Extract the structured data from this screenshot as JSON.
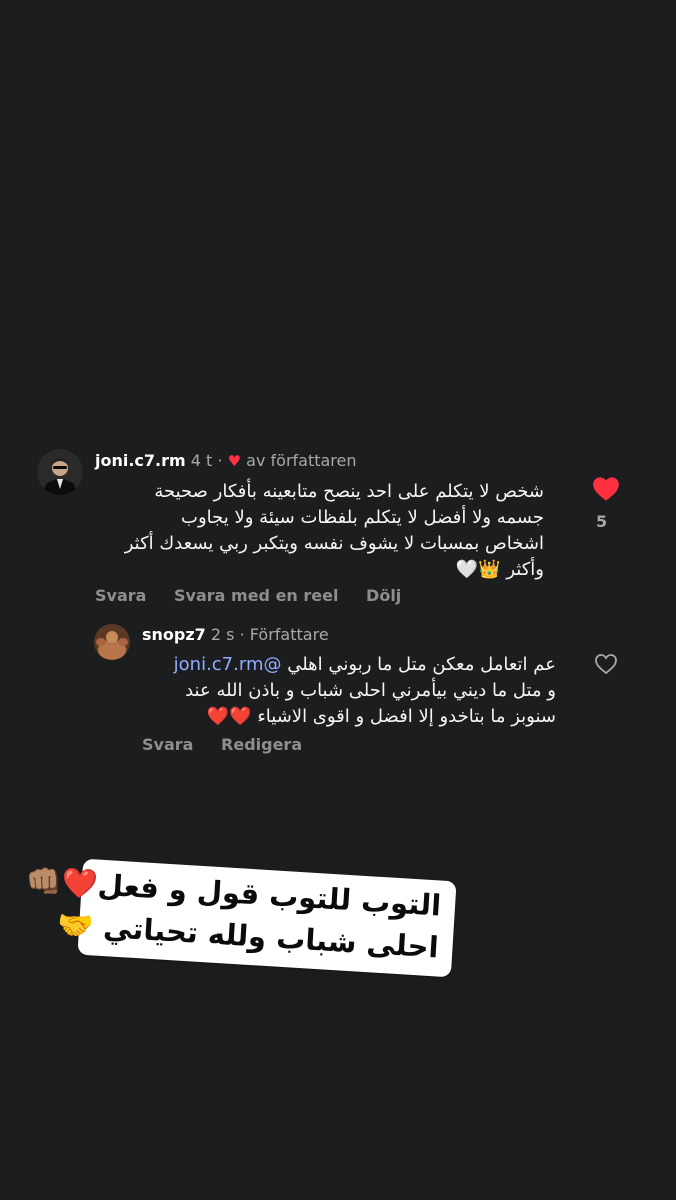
{
  "main_comment": {
    "username": "joni.c7.rm",
    "time": "4 t",
    "liked_by_author_label": "av författaren",
    "text": "شخص لا يتكلم على احد ينصح متابعينه بأفكار صحيحة\nجسمه ولا أفضل لا يتكلم بلفظات سيئة ولا يجاوب\nاشخاص بمسبات لا يشوف نفسه ويتكبر ربي يسعدك أكثر\nوأكثر 👑🤍",
    "like_count": "5",
    "actions": [
      "Svara",
      "Svara med en reel",
      "Dölj"
    ]
  },
  "reply_comment": {
    "username": "snopz7",
    "time": "2 s",
    "role": "Författare",
    "mention": "@joni.c7.rm",
    "text_line_1": "عم اتعامل معكن متل ما ربوني اهلي",
    "text_rest": "و متل ما ديني بيأمرني احلى شباب و باذن الله عند\nسنوبز ما بتاخدو إلا افضل و اقوى الاشياء ❤️❤️",
    "actions": [
      "Svara",
      "Redigera"
    ]
  },
  "sticker": {
    "line_1": "التوب للتوب قول و فعل❤️👊🏽",
    "line_2": "احلى شباب ولله تحياتي 🤝"
  },
  "colors": {
    "background": "#1a1c1e",
    "like_red": "#ff3040",
    "mention_blue": "#8faeff",
    "muted_text": "#8e8e8e"
  },
  "icons": {
    "like_filled": "heart-filled-icon",
    "like_outline": "heart-outline-icon"
  }
}
